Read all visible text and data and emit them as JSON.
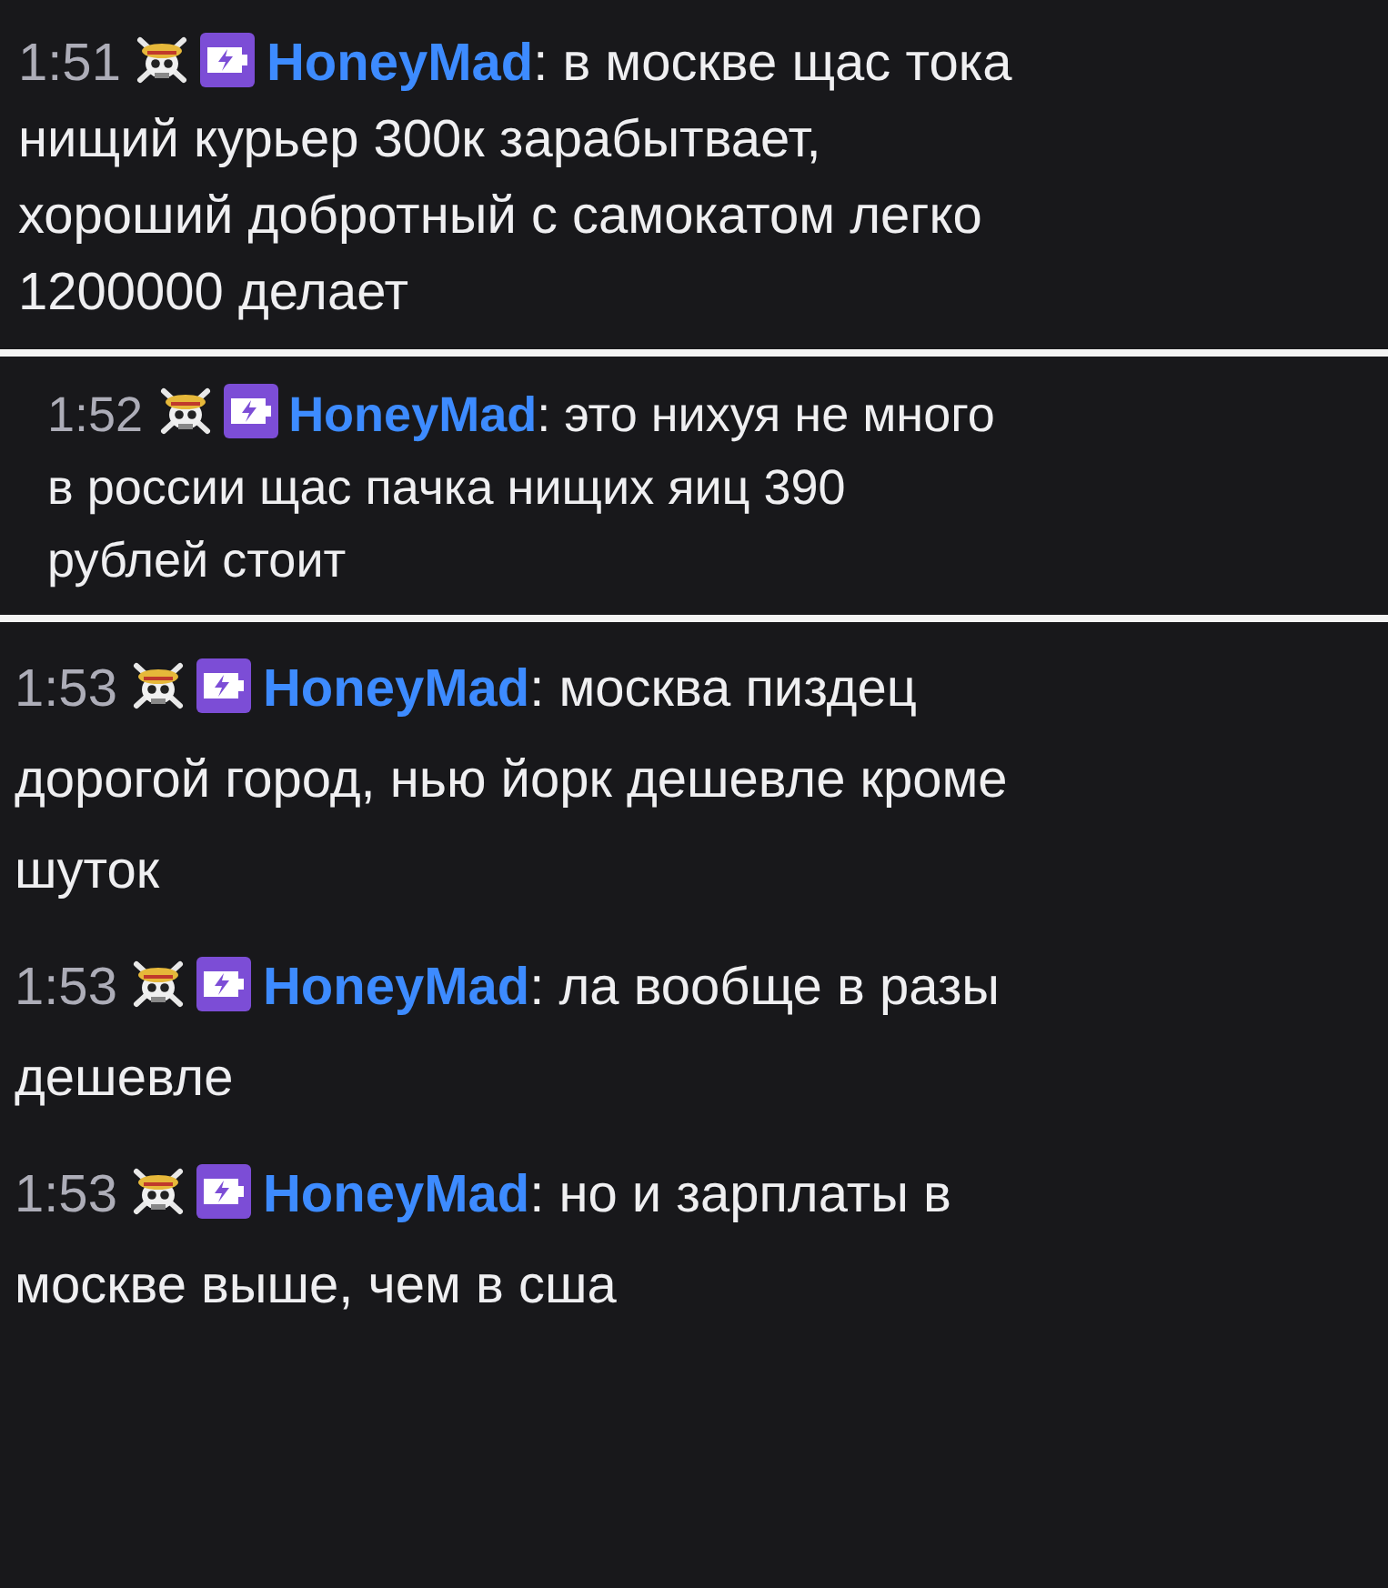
{
  "panels": [
    {
      "messages": [
        {
          "time": "1:51",
          "user": "HoneyMad",
          "lines": [
            ": в москве щас тока",
            "нищий курьер 300к зарабытвает,",
            "хороший добротный с самокатом легко",
            "1200000 делает"
          ]
        }
      ]
    },
    {
      "messages": [
        {
          "time": "1:52",
          "user": "HoneyMad",
          "lines": [
            ": это нихуя не много",
            "в россии щас пачка нищих яиц 390",
            "рублей стоит"
          ]
        }
      ]
    },
    {
      "messages": [
        {
          "time": "1:53",
          "user": "HoneyMad",
          "lines": [
            ": москва пиздец",
            "дорогой город, нью йорк дешевле кроме",
            "шуток"
          ]
        },
        {
          "time": "1:53",
          "user": "HoneyMad",
          "lines": [
            ": ла вообще в разы",
            "дешевле"
          ]
        },
        {
          "time": "1:53",
          "user": "HoneyMad",
          "lines": [
            ": но и зарплаты в",
            "москве выше, чем в сша"
          ]
        }
      ]
    }
  ]
}
